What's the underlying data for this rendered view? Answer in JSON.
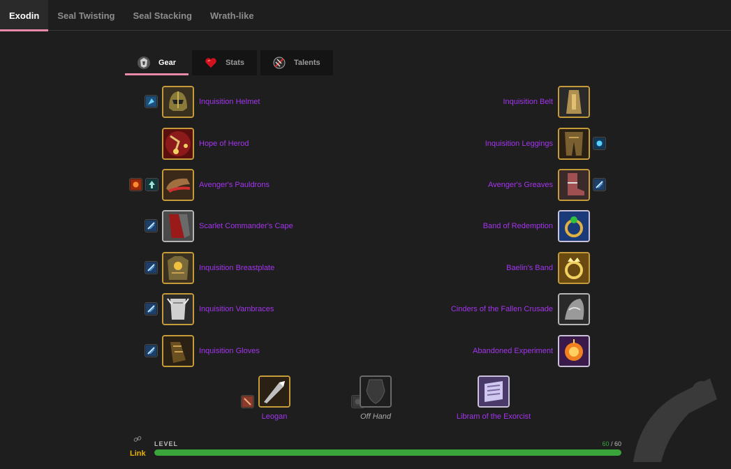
{
  "top_tabs": [
    {
      "label": "Exodin",
      "active": true
    },
    {
      "label": "Seal Twisting",
      "active": false
    },
    {
      "label": "Seal Stacking",
      "active": false
    },
    {
      "label": "Wrath-like",
      "active": false
    }
  ],
  "inner_tabs": [
    {
      "label": "Gear",
      "icon": "armor-icon",
      "active": true
    },
    {
      "label": "Stats",
      "icon": "heart-icon",
      "active": false
    },
    {
      "label": "Talents",
      "icon": "talent-icon",
      "active": false
    }
  ],
  "gear_left": [
    {
      "name": "Inquisition Helmet",
      "icon": "helmet-icon",
      "enchants": [
        "helm-enchant-icon"
      ]
    },
    {
      "name": "Hope of Herod",
      "icon": "amulet-icon",
      "enchants": []
    },
    {
      "name": "Avenger's Pauldrons",
      "icon": "shoulder-icon",
      "enchants": [
        "shoulder-enchant-icon",
        "rune-icon"
      ]
    },
    {
      "name": "Scarlet Commander's Cape",
      "icon": "cape-icon",
      "enchants": [
        "enchant-scroll-icon"
      ]
    },
    {
      "name": "Inquisition Breastplate",
      "icon": "chest-icon",
      "enchants": [
        "enchant-scroll-icon"
      ]
    },
    {
      "name": "Inquisition Vambraces",
      "icon": "bracer-icon",
      "enchants": [
        "enchant-scroll-icon"
      ]
    },
    {
      "name": "Inquisition Gloves",
      "icon": "gloves-icon",
      "enchants": [
        "enchant-scroll-icon"
      ]
    }
  ],
  "gear_right": [
    {
      "name": "Inquisition Belt",
      "icon": "belt-icon",
      "enchants": []
    },
    {
      "name": "Inquisition Leggings",
      "icon": "legs-icon",
      "enchants": [
        "legs-enchant-icon"
      ]
    },
    {
      "name": "Avenger's Greaves",
      "icon": "boots-icon",
      "enchants": [
        "enchant-scroll-icon"
      ]
    },
    {
      "name": "Band of Redemption",
      "icon": "ring-icon",
      "enchants": []
    },
    {
      "name": "Baelin's Band",
      "icon": "ring-gold-icon",
      "enchants": []
    },
    {
      "name": "Cinders of the Fallen Crusade",
      "icon": "trinket-icon",
      "enchants": []
    },
    {
      "name": "Abandoned Experiment",
      "icon": "trinket-orb-icon",
      "enchants": []
    }
  ],
  "weapons": [
    {
      "name": "Leogan",
      "icon": "sword-icon",
      "enchant": "weapon-enchant-icon",
      "empty": false
    },
    {
      "name": "Off Hand",
      "icon": "shield-icon",
      "enchant": "empty-socket-icon",
      "empty": true
    },
    {
      "name": "Libram of the Exorcist",
      "icon": "libram-icon",
      "enchant": null,
      "empty": false
    }
  ],
  "link": {
    "label": "Link",
    "icon": "link-icon"
  },
  "level": {
    "label": "LEVEL",
    "current": "60",
    "separator": " / ",
    "max": "60",
    "fraction": 1.0
  },
  "colors": {
    "accent": "#e88aa8",
    "epic": "#a335ee",
    "level_bar": "#3aa53a",
    "link": "#e8b400"
  }
}
